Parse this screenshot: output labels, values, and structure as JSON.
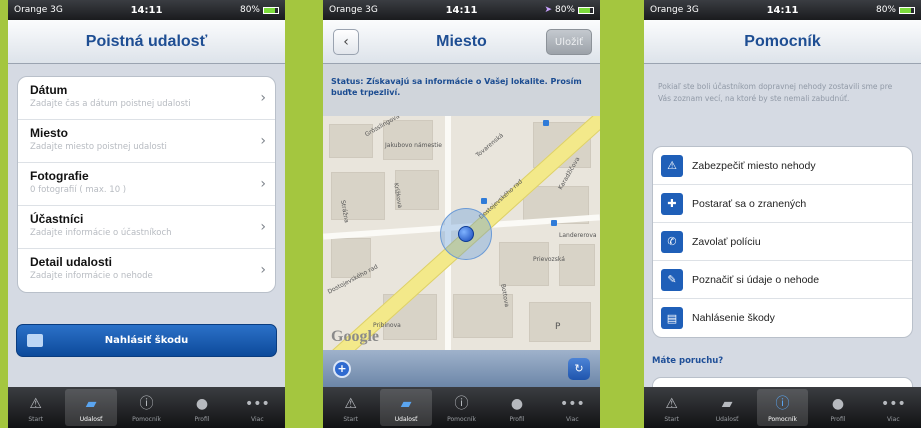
{
  "status": {
    "carrier": "Orange 3G",
    "time": "14:11",
    "battery": "80%"
  },
  "tabs": [
    {
      "label": "Start",
      "icon": "warning-triangle-icon"
    },
    {
      "label": "Udalosť",
      "icon": "folder-icon"
    },
    {
      "label": "Pomocník",
      "icon": "info-circle-icon"
    },
    {
      "label": "Profil",
      "icon": "person-icon"
    },
    {
      "label": "Viac",
      "icon": "more-dots-icon"
    }
  ],
  "screen1": {
    "title": "Poistná udalosť",
    "items": [
      {
        "title": "Dátum",
        "subtitle": "Zadajte čas a dátum poistnej udalosti"
      },
      {
        "title": "Miesto",
        "subtitle": "Zadajte miesto poistnej udalosti"
      },
      {
        "title": "Fotografie",
        "subtitle": "0 fotografií ( max. 10 )"
      },
      {
        "title": "Účastníci",
        "subtitle": "Zadajte informácie o účastníkoch"
      },
      {
        "title": "Detail udalosti",
        "subtitle": "Zadajte informácie o nehode"
      }
    ],
    "report_button": "Nahlásiť škodu"
  },
  "screen2": {
    "title": "Miesto",
    "save_button": "Uložiť",
    "status_message": "Status: Získavajú sa informácie o Vašej lokalite. Prosím buďte trpezliví.",
    "map_labels": [
      "Jakubovo námestie",
      "Tovarenská",
      "Grösslingová",
      "Karadžičova",
      "Landererova",
      "Krížkova",
      "Dostojevského rad",
      "Dostojevského rad",
      "Strážna",
      "Bottova",
      "Prievozská",
      "Pribinova",
      "P"
    ],
    "map_brand": "Google"
  },
  "screen3": {
    "title": "Pomocník",
    "intro": "Pokiaľ ste boli účastníkom dopravnej nehody zostavili sme pre Vás zoznam vecí, na ktoré by ste nemali zabudnúť.",
    "items": [
      {
        "label": "Zabezpečiť miesto nehody",
        "icon": "warning-icon"
      },
      {
        "label": "Postarať sa o zranených",
        "icon": "first-aid-icon"
      },
      {
        "label": "Zavolať políciu",
        "icon": "phone-icon"
      },
      {
        "label": "Poznačiť si údaje o nehode",
        "icon": "note-icon"
      },
      {
        "label": "Nahlásenie škody",
        "icon": "document-icon"
      }
    ],
    "breakdown_heading": "Máte poruchu?"
  }
}
